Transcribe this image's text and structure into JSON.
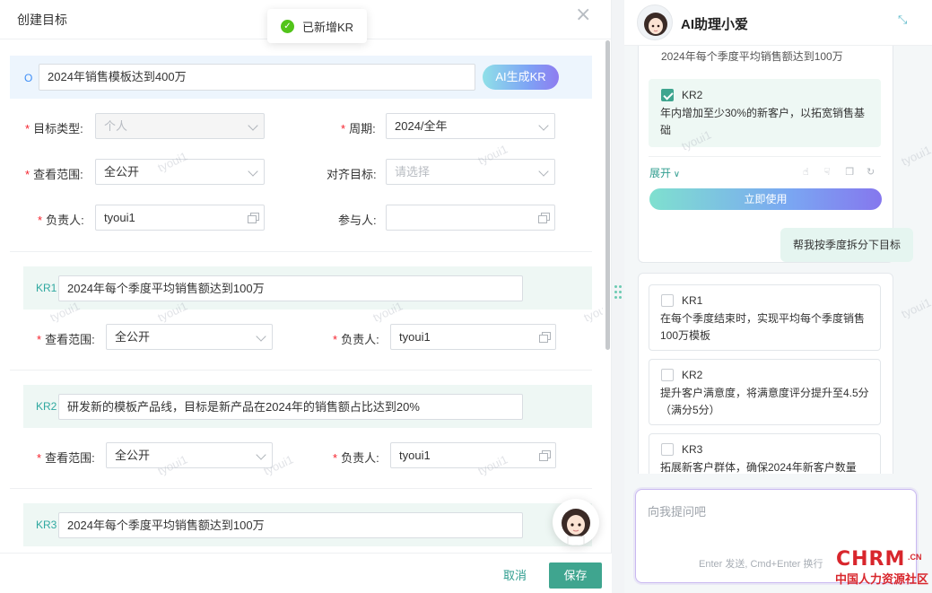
{
  "dialog": {
    "title": "创建目标",
    "close_icon": "close-icon",
    "toast": {
      "text": "已新增KR",
      "icon": "check-circle-icon",
      "color": "#52c41a"
    },
    "objective": {
      "tag": "O",
      "value": "2024年销售模板达到400万",
      "ai_button": "AI生成KR"
    },
    "form": {
      "type_label": "目标类型:",
      "type_value": "个人",
      "period_label": "周期:",
      "period_value": "2024/全年",
      "scope_label": "查看范围:",
      "scope_value": "全公开",
      "align_label": "对齐目标:",
      "align_placeholder": "请选择",
      "owner_label": "负责人:",
      "owner_value": "tyoui1",
      "participant_label": "参与人:",
      "participant_value": ""
    },
    "krs": [
      {
        "tag": "KR1",
        "text": "2024年每个季度平均销售额达到100万",
        "scope_label": "查看范围:",
        "scope_value": "全公开",
        "owner_label": "负责人:",
        "owner_value": "tyoui1"
      },
      {
        "tag": "KR2",
        "text": "研发新的模板产品线，目标是新产品在2024年的销售额占比达到20%",
        "scope_label": "查看范围:",
        "scope_value": "全公开",
        "owner_label": "负责人:",
        "owner_value": "tyoui1"
      },
      {
        "tag": "KR3",
        "text": "2024年每个季度平均销售额达到100万"
      }
    ],
    "watermark": "tyoui1",
    "footer": {
      "cancel": "取消",
      "save": "保存"
    }
  },
  "panel": {
    "title": "AI助理小爱",
    "collapse_icon": "collapse-icon",
    "card1": {
      "prev_text": "2024年每个季度平均销售额达到100万",
      "kr_name": "KR2",
      "kr_text": "年内增加至少30%的新客户，以拓宽销售基础",
      "expand": "展开",
      "use_button": "立即使用",
      "feedback_icons": [
        "thumbs-up-icon",
        "thumbs-down-icon",
        "copy-icon",
        "refresh-icon"
      ]
    },
    "user_message": "帮我按季度拆分下目标",
    "card2": {
      "items": [
        {
          "name": "KR1",
          "text": "在每个季度结束时，实现平均每个季度销售100万模板"
        },
        {
          "name": "KR2",
          "text": "提升客户满意度，将满意度评分提升至4.5分（满分5分）"
        },
        {
          "name": "KR3",
          "text": "拓展新客户群体，确保2024年新客户数量"
        }
      ]
    },
    "input": {
      "placeholder": "向我提问吧",
      "hint": "Enter 发送, Cmd+Enter 换行"
    }
  },
  "logo": {
    "brand": "CHRM",
    "suffix": ".CN",
    "tagline": "中国人力资源社区"
  },
  "colors": {
    "accent": "#3fa58f",
    "objective_bg": "#edf5fd",
    "kr_bg": "#eef7f4",
    "required": "#f5222d"
  }
}
